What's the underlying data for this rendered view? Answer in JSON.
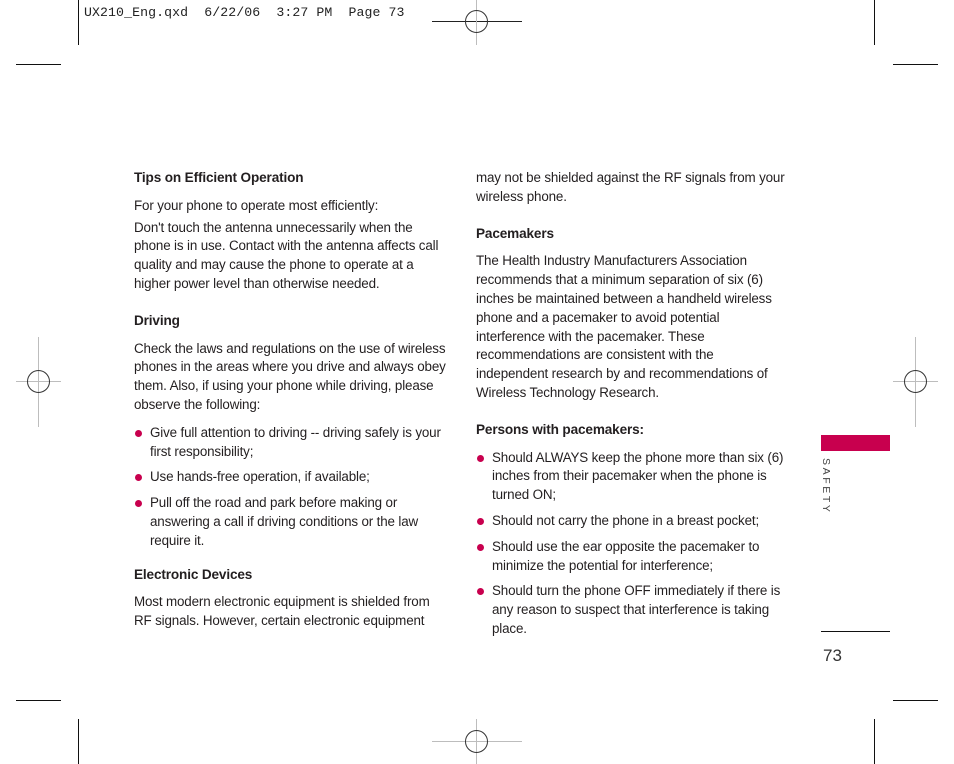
{
  "slug_line": "UX210_Eng.qxd  6/22/06  3:27 PM  Page 73",
  "left_column": {
    "tips": {
      "heading": "Tips on Efficient Operation",
      "intro": "For your phone to operate most efficiently:",
      "body": "Don't touch the antenna unnecessarily when the phone is in use. Contact with the antenna affects call quality and may cause the phone to operate at a higher power level than otherwise needed."
    },
    "driving": {
      "heading": "Driving",
      "body": "Check the laws and regulations on the use of wireless phones in the areas where you drive and always obey them. Also, if using your phone while driving, please observe the following:",
      "bullets": [
        "Give full attention to driving -- driving safely is your first responsibility;",
        "Use hands-free operation, if available;",
        "Pull off the road and park before making or answering a call if driving conditions or the law require it."
      ]
    },
    "electronic_devices": {
      "heading": "Electronic Devices",
      "body": "Most modern electronic equipment is shielded from RF signals. However, certain electronic equipment"
    }
  },
  "right_column": {
    "continuation": "may not be shielded against the RF signals from your wireless phone.",
    "pacemakers": {
      "heading": "Pacemakers",
      "body": "The Health Industry Manufacturers Association recommends that a minimum separation of six (6) inches be maintained between a handheld wireless phone and a pacemaker to avoid potential interference with the pacemaker. These recommendations are consistent with the independent research by and recommendations of Wireless Technology Research."
    },
    "persons": {
      "heading": "Persons with pacemakers:",
      "bullets": [
        "Should ALWAYS keep the phone more than six (6) inches from their pacemaker when the phone is turned ON;",
        "Should not carry the phone in a breast pocket;",
        "Should use the ear opposite the pacemaker to minimize the potential for interference;",
        "Should turn the phone OFF immediately if there is any reason to suspect that interference is taking place."
      ]
    }
  },
  "side_tab": {
    "label": "SAFETY",
    "color": "#c8004e"
  },
  "page_number": "73",
  "bullet_color": "#c8004e"
}
